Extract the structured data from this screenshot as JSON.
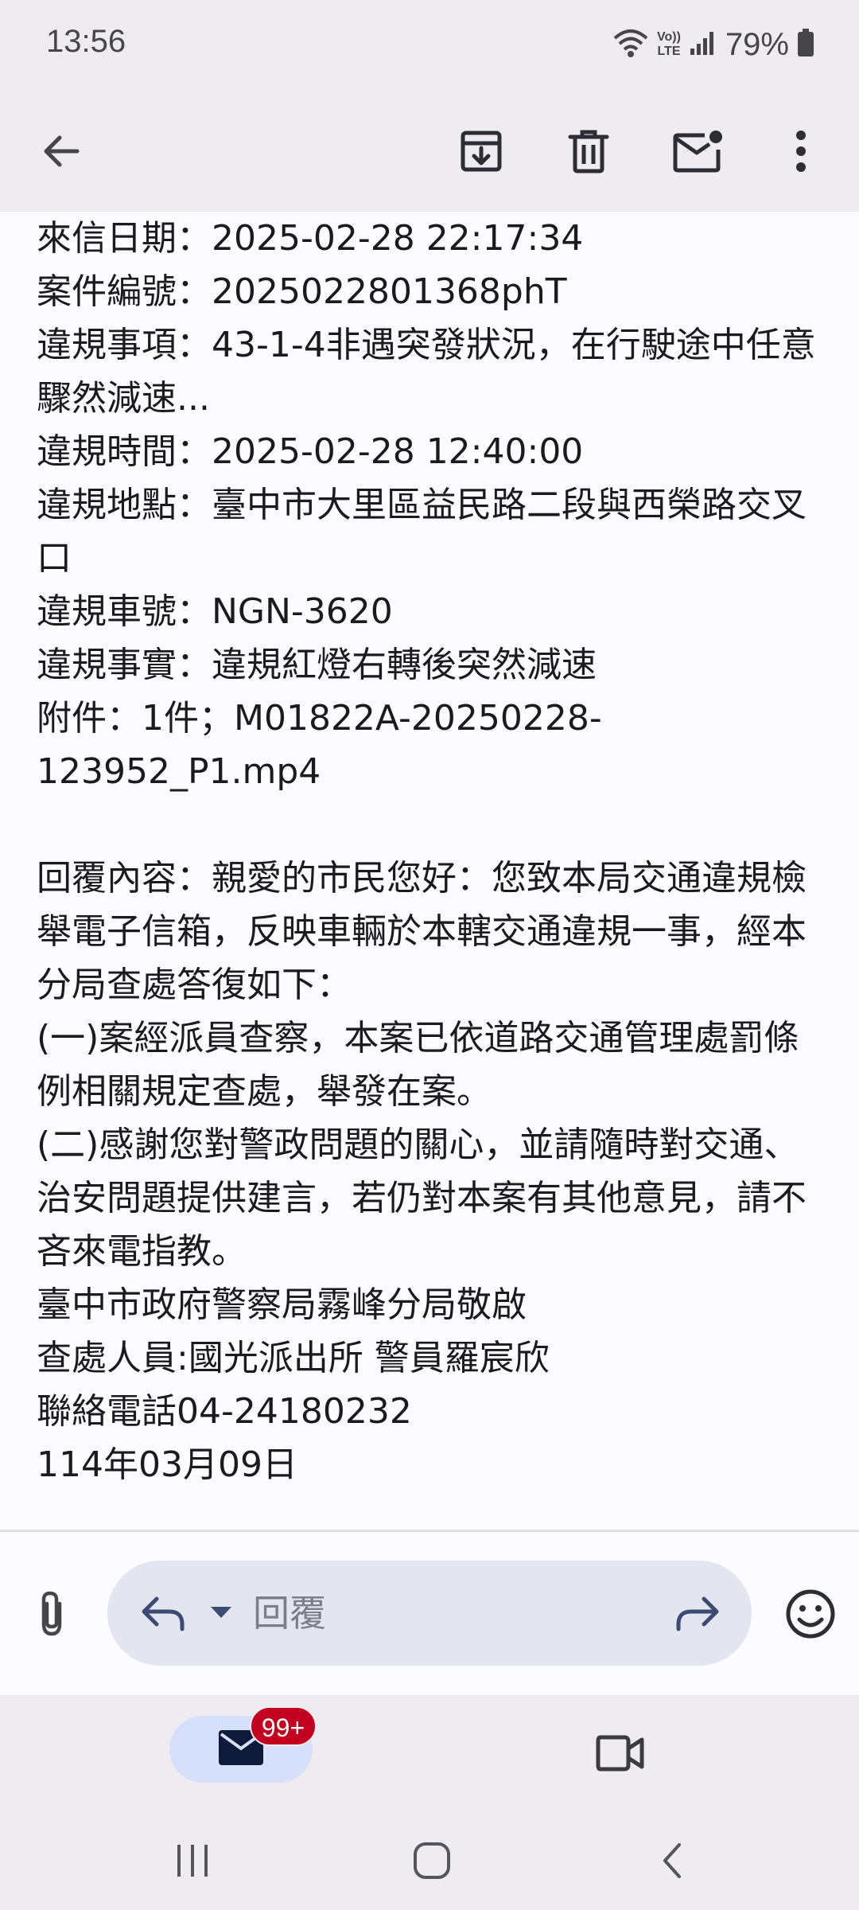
{
  "status_bar": {
    "time": "13:56",
    "volte_label_top": "Vo))",
    "volte_label_bottom": "LTE",
    "battery_percent": "79%"
  },
  "toolbar": {
    "back_icon": "arrow-left-icon",
    "archive_icon": "archive-icon",
    "delete_icon": "trash-icon",
    "mark_unread_icon": "mail-unread-icon",
    "more_icon": "more-vertical-icon"
  },
  "email_body": {
    "lines": [
      "來信日期：2025-02-28 22:17:34",
      "案件編號：2025022801368phT",
      "違規事項：43-1-4非遇突發狀況，在行駛途中任意驟然減速...",
      "違規時間：2025-02-28 12:40:00",
      "違規地點：臺中市大里區益民路二段與西榮路交叉口",
      "違規車號：NGN-3620",
      "違規事實：違規紅燈右轉後突然減速",
      "附件：1件；M01822A-20250228-123952_P1.mp4",
      "",
      "回覆內容：親愛的市民您好：您致本局交通違規檢舉電子信箱，反映車輛於本轄交通違規一事，經本分局查處答復如下：",
      "(一)案經派員查察，本案已依道路交通管理處罰條例相關規定查處，舉發在案。",
      "(二)感謝您對警政問題的關心，並請隨時對交通、治安問題提供建言，若仍對本案有其他意見，請不吝來電指教。",
      "臺中市政府警察局霧峰分局敬啟",
      "查處人員:國光派出所 警員羅宸欣",
      "聯絡電話04-24180232",
      "114年03月09日"
    ]
  },
  "reply_bar": {
    "attach_icon": "paperclip-icon",
    "reply_icon": "reply-icon",
    "reply_options_icon": "caret-down-icon",
    "reply_placeholder": "回覆",
    "forward_icon": "forward-icon",
    "emoji_icon": "emoji-icon"
  },
  "bottom_nav": {
    "mail_icon": "mail-icon",
    "mail_badge": "99+",
    "meet_icon": "video-camera-icon"
  },
  "system_nav": {
    "recents_icon": "recents-icon",
    "home_icon": "home-icon",
    "back_icon": "back-chevron-icon"
  },
  "colors": {
    "background": "#eeecf1",
    "content_background": "#fcfbff",
    "reply_pill": "#e3e5f1",
    "mail_tab_active": "#d6e0fb",
    "badge": "#c3001f",
    "icon_dark": "#46464a"
  }
}
